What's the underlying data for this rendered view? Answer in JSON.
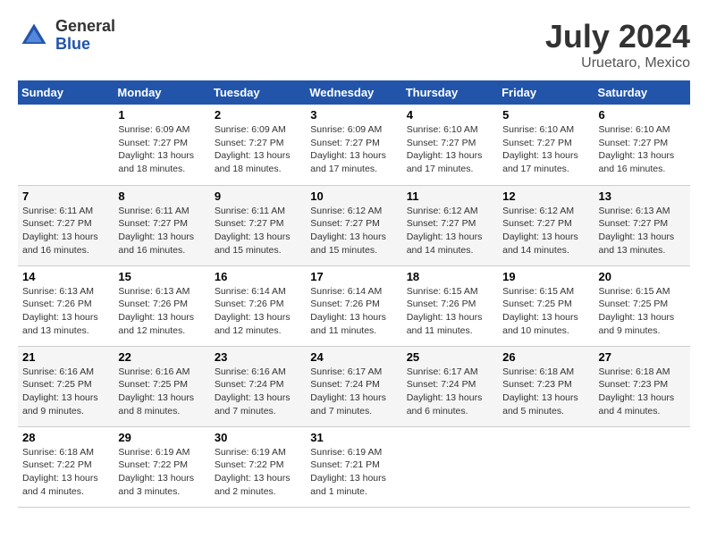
{
  "header": {
    "logo_general": "General",
    "logo_blue": "Blue",
    "title": "July 2024",
    "location": "Uruetaro, Mexico"
  },
  "days_of_week": [
    "Sunday",
    "Monday",
    "Tuesday",
    "Wednesday",
    "Thursday",
    "Friday",
    "Saturday"
  ],
  "weeks": [
    [
      {
        "day": "",
        "info": ""
      },
      {
        "day": "1",
        "info": "Sunrise: 6:09 AM\nSunset: 7:27 PM\nDaylight: 13 hours\nand 18 minutes."
      },
      {
        "day": "2",
        "info": "Sunrise: 6:09 AM\nSunset: 7:27 PM\nDaylight: 13 hours\nand 18 minutes."
      },
      {
        "day": "3",
        "info": "Sunrise: 6:09 AM\nSunset: 7:27 PM\nDaylight: 13 hours\nand 17 minutes."
      },
      {
        "day": "4",
        "info": "Sunrise: 6:10 AM\nSunset: 7:27 PM\nDaylight: 13 hours\nand 17 minutes."
      },
      {
        "day": "5",
        "info": "Sunrise: 6:10 AM\nSunset: 7:27 PM\nDaylight: 13 hours\nand 17 minutes."
      },
      {
        "day": "6",
        "info": "Sunrise: 6:10 AM\nSunset: 7:27 PM\nDaylight: 13 hours\nand 16 minutes."
      }
    ],
    [
      {
        "day": "7",
        "info": "Sunrise: 6:11 AM\nSunset: 7:27 PM\nDaylight: 13 hours\nand 16 minutes."
      },
      {
        "day": "8",
        "info": "Sunrise: 6:11 AM\nSunset: 7:27 PM\nDaylight: 13 hours\nand 16 minutes."
      },
      {
        "day": "9",
        "info": "Sunrise: 6:11 AM\nSunset: 7:27 PM\nDaylight: 13 hours\nand 15 minutes."
      },
      {
        "day": "10",
        "info": "Sunrise: 6:12 AM\nSunset: 7:27 PM\nDaylight: 13 hours\nand 15 minutes."
      },
      {
        "day": "11",
        "info": "Sunrise: 6:12 AM\nSunset: 7:27 PM\nDaylight: 13 hours\nand 14 minutes."
      },
      {
        "day": "12",
        "info": "Sunrise: 6:12 AM\nSunset: 7:27 PM\nDaylight: 13 hours\nand 14 minutes."
      },
      {
        "day": "13",
        "info": "Sunrise: 6:13 AM\nSunset: 7:27 PM\nDaylight: 13 hours\nand 13 minutes."
      }
    ],
    [
      {
        "day": "14",
        "info": "Sunrise: 6:13 AM\nSunset: 7:26 PM\nDaylight: 13 hours\nand 13 minutes."
      },
      {
        "day": "15",
        "info": "Sunrise: 6:13 AM\nSunset: 7:26 PM\nDaylight: 13 hours\nand 12 minutes."
      },
      {
        "day": "16",
        "info": "Sunrise: 6:14 AM\nSunset: 7:26 PM\nDaylight: 13 hours\nand 12 minutes."
      },
      {
        "day": "17",
        "info": "Sunrise: 6:14 AM\nSunset: 7:26 PM\nDaylight: 13 hours\nand 11 minutes."
      },
      {
        "day": "18",
        "info": "Sunrise: 6:15 AM\nSunset: 7:26 PM\nDaylight: 13 hours\nand 11 minutes."
      },
      {
        "day": "19",
        "info": "Sunrise: 6:15 AM\nSunset: 7:25 PM\nDaylight: 13 hours\nand 10 minutes."
      },
      {
        "day": "20",
        "info": "Sunrise: 6:15 AM\nSunset: 7:25 PM\nDaylight: 13 hours\nand 9 minutes."
      }
    ],
    [
      {
        "day": "21",
        "info": "Sunrise: 6:16 AM\nSunset: 7:25 PM\nDaylight: 13 hours\nand 9 minutes."
      },
      {
        "day": "22",
        "info": "Sunrise: 6:16 AM\nSunset: 7:25 PM\nDaylight: 13 hours\nand 8 minutes."
      },
      {
        "day": "23",
        "info": "Sunrise: 6:16 AM\nSunset: 7:24 PM\nDaylight: 13 hours\nand 7 minutes."
      },
      {
        "day": "24",
        "info": "Sunrise: 6:17 AM\nSunset: 7:24 PM\nDaylight: 13 hours\nand 7 minutes."
      },
      {
        "day": "25",
        "info": "Sunrise: 6:17 AM\nSunset: 7:24 PM\nDaylight: 13 hours\nand 6 minutes."
      },
      {
        "day": "26",
        "info": "Sunrise: 6:18 AM\nSunset: 7:23 PM\nDaylight: 13 hours\nand 5 minutes."
      },
      {
        "day": "27",
        "info": "Sunrise: 6:18 AM\nSunset: 7:23 PM\nDaylight: 13 hours\nand 4 minutes."
      }
    ],
    [
      {
        "day": "28",
        "info": "Sunrise: 6:18 AM\nSunset: 7:22 PM\nDaylight: 13 hours\nand 4 minutes."
      },
      {
        "day": "29",
        "info": "Sunrise: 6:19 AM\nSunset: 7:22 PM\nDaylight: 13 hours\nand 3 minutes."
      },
      {
        "day": "30",
        "info": "Sunrise: 6:19 AM\nSunset: 7:22 PM\nDaylight: 13 hours\nand 2 minutes."
      },
      {
        "day": "31",
        "info": "Sunrise: 6:19 AM\nSunset: 7:21 PM\nDaylight: 13 hours\nand 1 minute."
      },
      {
        "day": "",
        "info": ""
      },
      {
        "day": "",
        "info": ""
      },
      {
        "day": "",
        "info": ""
      }
    ]
  ]
}
